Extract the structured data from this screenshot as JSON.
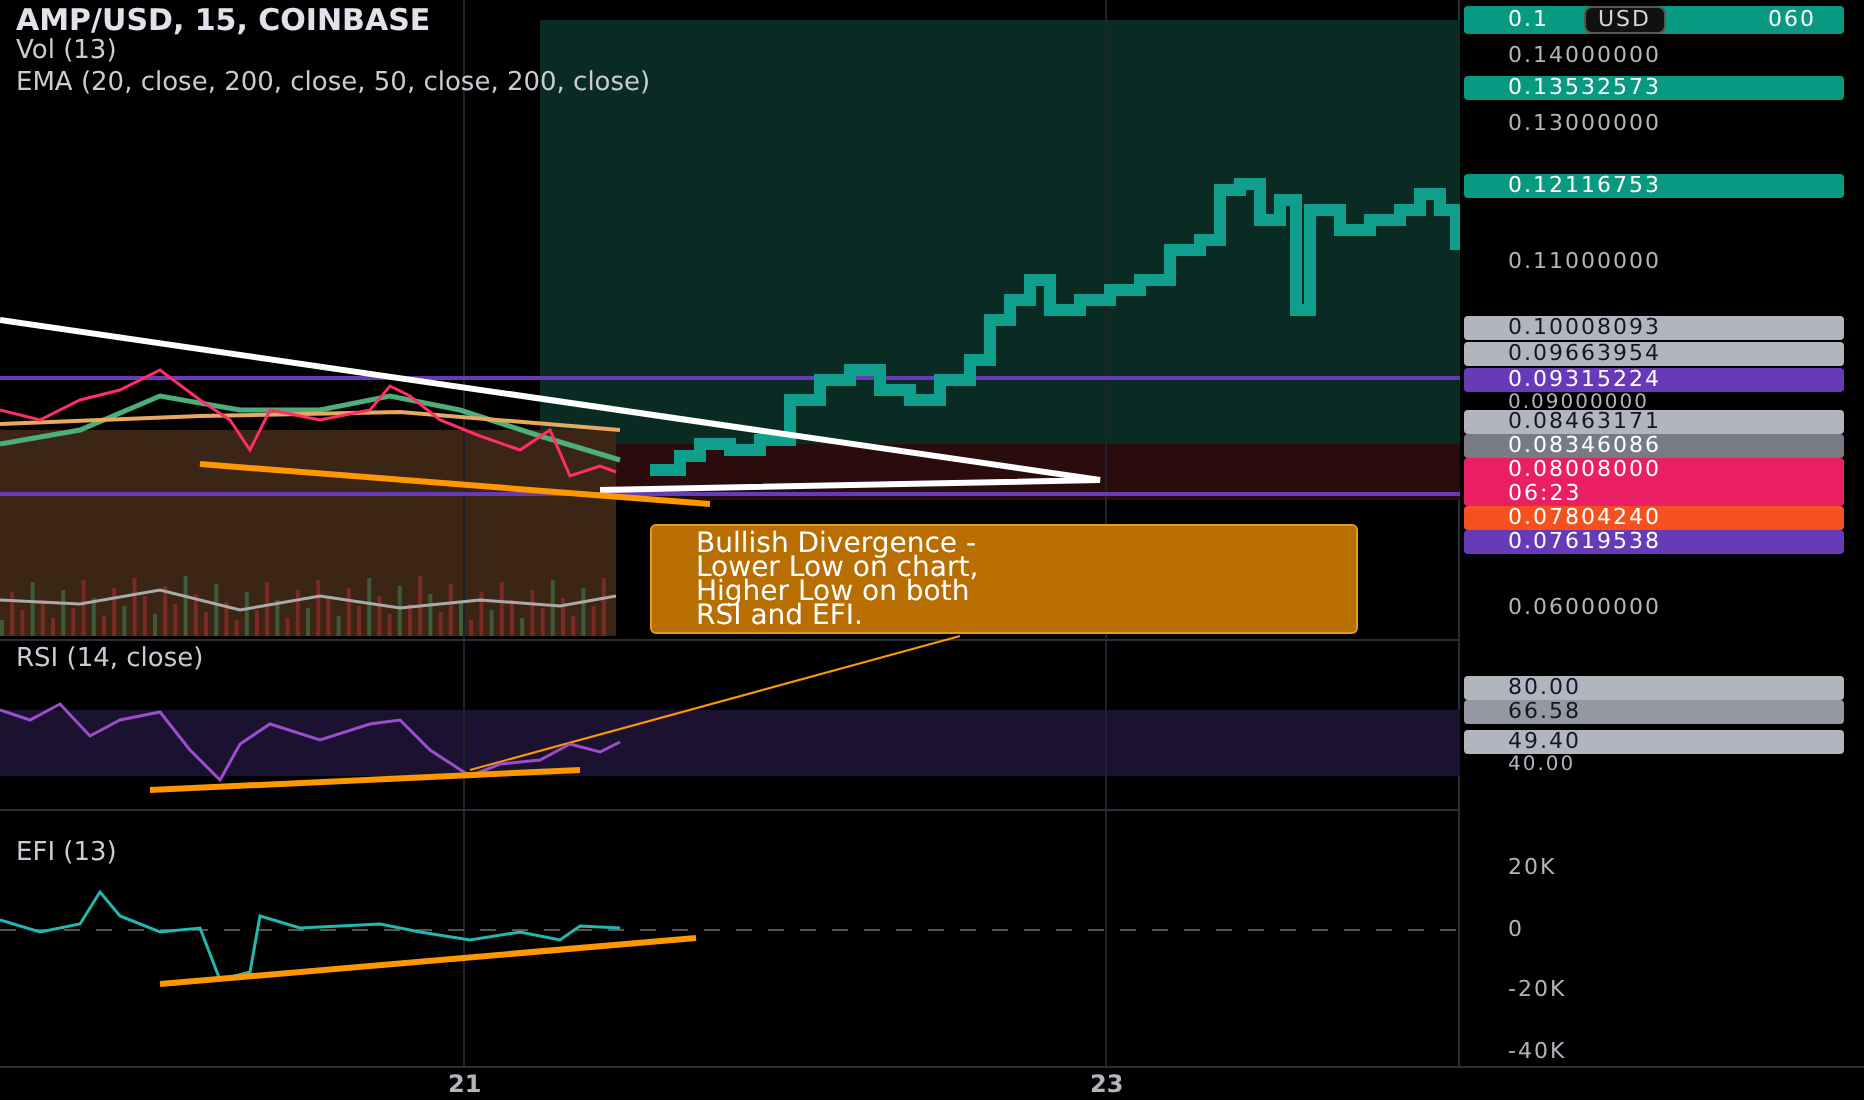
{
  "legend": {
    "symbol": "AMP/USD, 15, COINBASE",
    "indicators": [
      "Vol (13)",
      "EMA (20, close, 200, close, 50, close, 200, close)"
    ]
  },
  "price_axis": {
    "currency": "USD",
    "labels": [
      {
        "kind": "split",
        "text": "0.1",
        "text_end": "060",
        "color": "#089981"
      },
      {
        "kind": "tick",
        "text": "0.14000000"
      },
      {
        "kind": "marker",
        "text": "0.13532573",
        "color": "#089981"
      },
      {
        "kind": "tick",
        "text": "0.13000000"
      },
      {
        "kind": "marker",
        "text": "0.12116753",
        "color": "#089981"
      },
      {
        "kind": "tick",
        "text": "0.11000000"
      },
      {
        "kind": "marker",
        "text": "0.10008093",
        "color": "#b2b5be"
      },
      {
        "kind": "marker",
        "text": "0.09663954",
        "color": "#b2b5be"
      },
      {
        "kind": "marker",
        "text": "0.09315224",
        "color": "#673ab7"
      },
      {
        "kind": "tick",
        "text": "0.09000000"
      },
      {
        "kind": "marker",
        "text": "0.08463171",
        "color": "#b2b5be"
      },
      {
        "kind": "marker",
        "text": "0.08346086",
        "color": "#787b86"
      },
      {
        "kind": "marker",
        "text": "0.08008000",
        "countdown": "06:23",
        "color": "#e91e63"
      },
      {
        "kind": "marker",
        "text": "0.07804240",
        "color": "#f4511e"
      },
      {
        "kind": "marker",
        "text": "0.07619538",
        "color": "#673ab7"
      },
      {
        "kind": "tick",
        "text": "0.06000000"
      }
    ]
  },
  "callout": {
    "lines": [
      "Bullish Divergence -",
      "Lower Low on chart,",
      "Higher Low on both",
      "RSI and EFI."
    ]
  },
  "rsi": {
    "title": "RSI (14, close)",
    "axis": [
      {
        "kind": "marker",
        "text": "80.00",
        "color": "#b2b5be"
      },
      {
        "kind": "marker",
        "text": "66.58",
        "color": "#9598a1"
      },
      {
        "kind": "marker",
        "text": "49.40",
        "color": "#b2b5be"
      },
      {
        "kind": "tick",
        "text": "40.00"
      }
    ]
  },
  "efi": {
    "title": "EFI (13)",
    "axis": [
      {
        "kind": "tick",
        "text": "20K"
      },
      {
        "kind": "tick",
        "text": "0"
      },
      {
        "kind": "tick",
        "text": "-20K"
      },
      {
        "kind": "tick",
        "text": "-40K"
      }
    ]
  },
  "time_axis": [
    "21",
    "23"
  ]
}
